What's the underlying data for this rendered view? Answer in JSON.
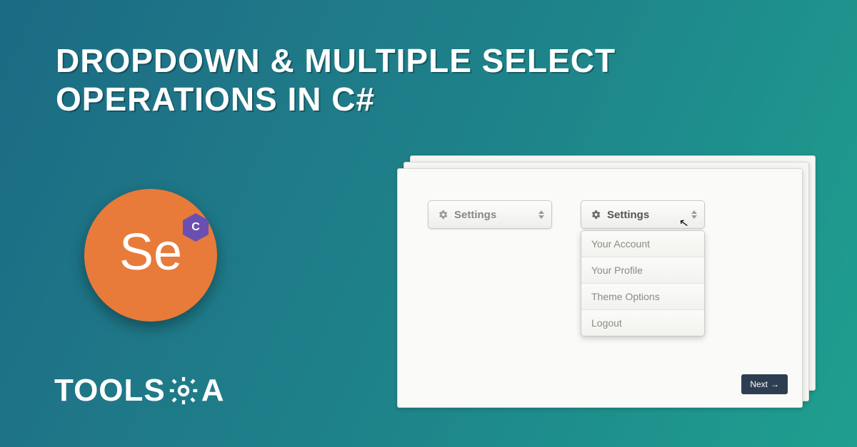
{
  "title_line1": "DROPDOWN & MULTIPLE SELECT",
  "title_line2": "OPERATIONS IN C#",
  "selenium_label": "Se",
  "selenium_badge": "C",
  "logo_prefix": "TOOLS",
  "logo_suffix": "A",
  "dropdown1_label": "Settings",
  "dropdown2_label": "Settings",
  "menu_items": {
    "0": "Your Account",
    "1": "Your Profile",
    "2": "Theme Options",
    "3": "Logout"
  },
  "next_label": "Next"
}
